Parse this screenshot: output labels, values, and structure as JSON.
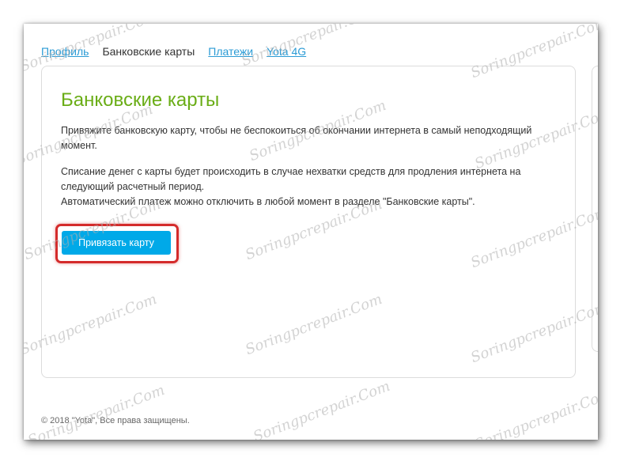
{
  "nav": {
    "tabs": [
      {
        "label": "Профиль",
        "active": false
      },
      {
        "label": "Банковские карты",
        "active": true
      },
      {
        "label": "Платежи",
        "active": false
      },
      {
        "label": "Yota 4G",
        "active": false
      }
    ]
  },
  "main": {
    "title": "Банковские карты",
    "paragraph1": "Привяжите банковскую карту, чтобы не беспокоиться об окончании интернета в самый неподходящий момент.",
    "paragraph2_line1": "Списание денег с карты будет происходить в случае нехватки средств для продления интернета на следующий расчетный период.",
    "paragraph2_line2": "Автоматический платеж можно отключить в любой момент в разделе \"Банковские карты\".",
    "bind_card_button": "Привязать карту"
  },
  "footer": {
    "copyright": "© 2018 \"Yota\", Все права защищены."
  },
  "watermark": "Soringpcrepair.Com",
  "colors": {
    "title_green": "#6aad16",
    "link_blue": "#2b9bd5",
    "button_blue": "#00a9e8",
    "highlight_red": "#d42b2b"
  }
}
